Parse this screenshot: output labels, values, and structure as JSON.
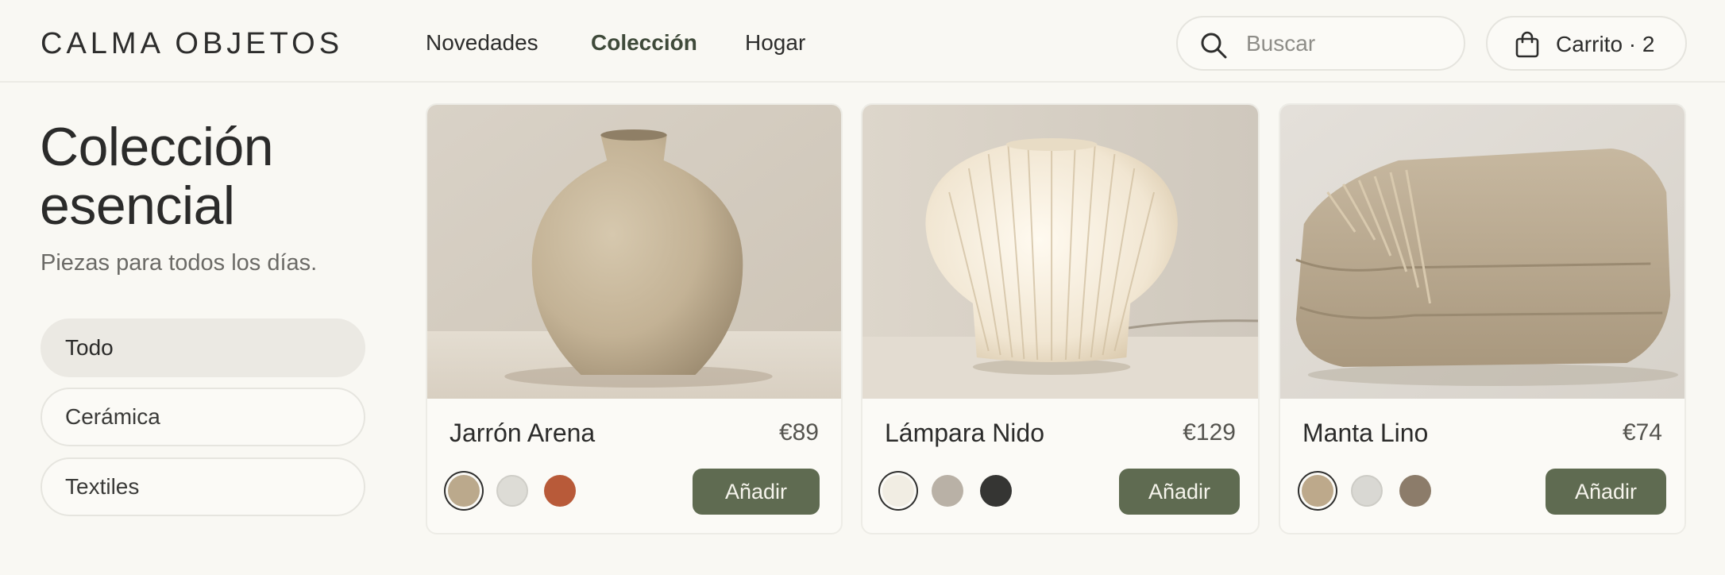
{
  "header": {
    "brand": "CALMA OBJETOS",
    "nav": [
      "Novedades",
      "Colección",
      "Hogar"
    ],
    "active_nav": "Colección",
    "search_placeholder": "Buscar",
    "cart_label": "Carrito · 2"
  },
  "sidebar": {
    "title": "Colección esencial",
    "subtitle": "Piezas para todos los días.",
    "filters": [
      "Todo",
      "Cerámica",
      "Textiles"
    ],
    "active_filter": "Todo"
  },
  "products": [
    {
      "name": "Jarrón Arena",
      "price": "€89",
      "button": "Añadir",
      "swatches": [
        "#bba98c",
        "#dddcd6",
        "#b85a39"
      ],
      "selected_swatch": 0,
      "image": "ceramic-vase"
    },
    {
      "name": "Lámpara Nido",
      "price": "€129",
      "button": "Añadir",
      "swatches": [
        "#f1ede3",
        "#b9b1a6",
        "#353533"
      ],
      "selected_swatch": 0,
      "image": "pleated-lamp"
    },
    {
      "name": "Manta Lino",
      "price": "€74",
      "button": "Añadir",
      "swatches": [
        "#bda98b",
        "#d9d8d3",
        "#8c7c6a"
      ],
      "selected_swatch": 0,
      "image": "folded-throw"
    }
  ],
  "colors": {
    "accent": "#5f6b51",
    "background": "#f9f8f3"
  }
}
